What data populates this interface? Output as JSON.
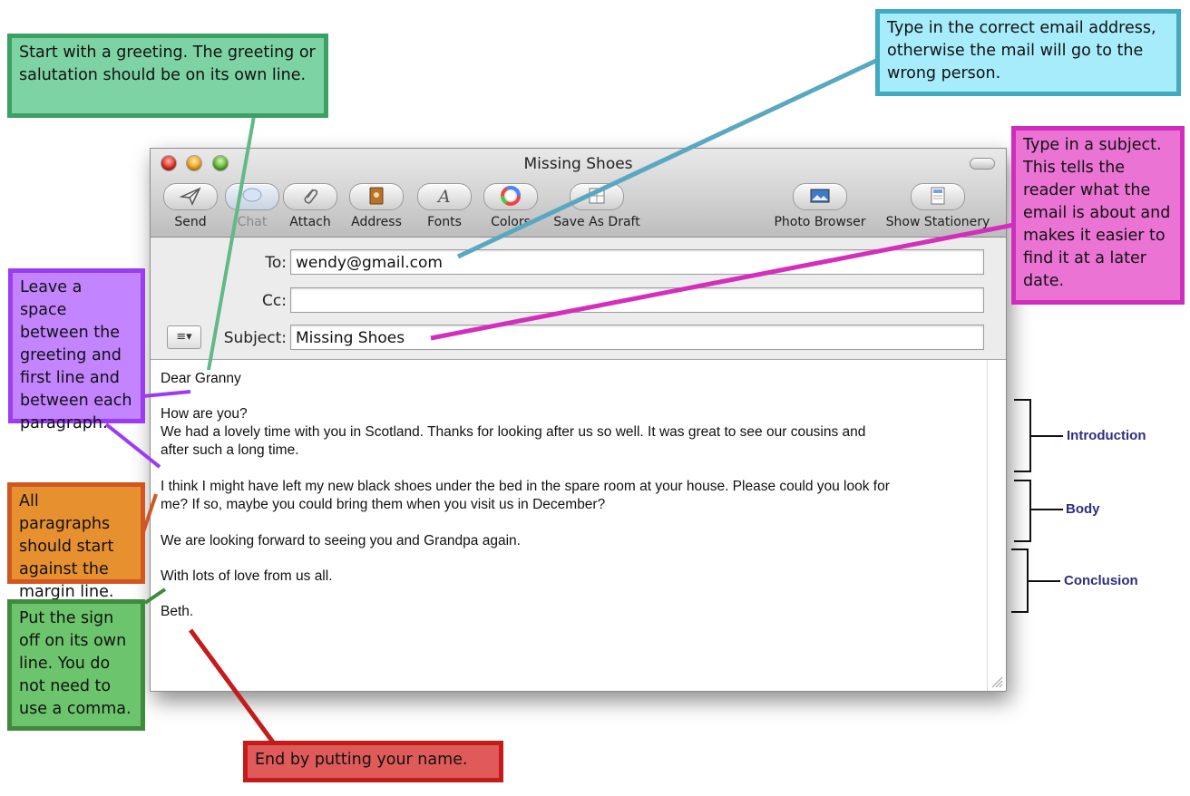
{
  "window": {
    "title": "Missing Shoes",
    "toolbar": [
      {
        "label": "Send",
        "icon": "send-icon",
        "enabled": true
      },
      {
        "label": "Chat",
        "icon": "chat-icon",
        "enabled": false
      },
      {
        "label": "Attach",
        "icon": "paperclip-icon",
        "enabled": true
      },
      {
        "label": "Address",
        "icon": "address-book-icon",
        "enabled": true
      },
      {
        "label": "Fonts",
        "icon": "fonts-icon",
        "enabled": true
      },
      {
        "label": "Colors",
        "icon": "color-wheel-icon",
        "enabled": true
      },
      {
        "label": "Save As Draft",
        "icon": "draft-icon",
        "enabled": true
      },
      {
        "label": "Photo Browser",
        "icon": "photo-icon",
        "enabled": true
      },
      {
        "label": "Show Stationery",
        "icon": "stationery-icon",
        "enabled": true
      }
    ]
  },
  "header": {
    "to_label": "To:",
    "to_value": "wendy@gmail.com",
    "cc_label": "Cc:",
    "cc_value": "",
    "subject_label": "Subject:",
    "subject_value": "Missing Shoes",
    "menu_glyph": "≡▾"
  },
  "body": {
    "greeting": "Dear Granny",
    "p1_line1": "How are you?",
    "p1_line2": "We had a lovely time with you in Scotland. Thanks for looking after us so well. It was great to see our cousins and",
    "p1_line3": "after such a long time.",
    "p2_line1": "I think I might have left my new black shoes under the bed in the spare room at your house. Please could you look for",
    "p2_line2": "me? If so, maybe you could bring them when you visit us in December?",
    "p3": "We are looking forward to seeing you and Grandpa again.",
    "p4": "With lots of love from us all.",
    "sign": "Beth."
  },
  "sections": {
    "introduction": "Introduction",
    "body": "Body",
    "conclusion": "Conclusion"
  },
  "callouts": {
    "greeting": "Start with a greeting. The greeting or salutation should be on its own line.",
    "email": "Type in the correct email address, otherwise the mail will go to the wrong person.",
    "subject": "Type in a subject. This tells the reader what the email is about and makes it easier to find it at a later date.",
    "spacing": "Leave a space between the greeting and first line and between each paragraph.",
    "paragraphs": "All paragraphs should start against the margin line.",
    "signoff": "Put the sign off on its own line. You do not need to use a comma.",
    "name": "End by putting your name."
  },
  "colors": {
    "greeting": "#7ed3a5",
    "email": "#a6ecfb",
    "subject": "#ea73d3",
    "spacing": "#c284ff",
    "paragraphs": "#e7902f",
    "signoff": "#6cc46c",
    "name": "#e05a5a",
    "section_labels": "#2d2e83"
  }
}
